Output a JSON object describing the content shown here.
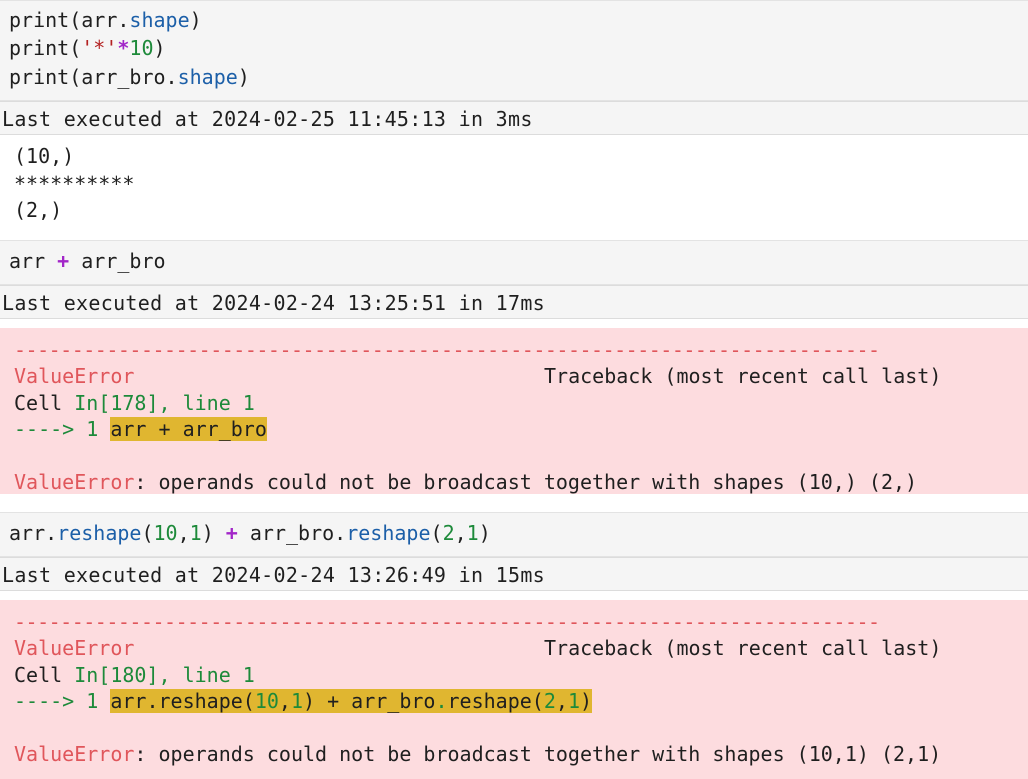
{
  "cells": [
    {
      "code_lines": [
        {
          "p1": "print(arr.",
          "p2": "shape",
          "p3": ")"
        },
        {
          "p1": "print(",
          "p2": "'*'",
          "p3": "*",
          "p4": "10",
          "p5": ")"
        },
        {
          "p1": "print(arr_bro.",
          "p2": "shape",
          "p3": ")"
        }
      ],
      "exec_info": "Last executed at 2024-02-25 11:45:13 in 3ms",
      "output_lines": [
        "(10,)",
        "**********",
        "(2,)"
      ]
    },
    {
      "code": {
        "p1": "arr ",
        "p2": "+",
        "p3": " arr_bro"
      },
      "exec_info": "Last executed at 2024-02-24 13:25:51 in 17ms",
      "error": {
        "separator": "---------------------------------------------------------------------------",
        "name": "ValueError",
        "traceback_label": "Traceback (most recent call last)",
        "cell_prefix": "Cell ",
        "cell_ref": "In[178], line 1",
        "arrow": "----> 1 ",
        "src": {
          "p1": "arr ",
          "p2": "+",
          "p3": " arr_bro"
        },
        "message": ": operands could not be broadcast together with shapes (10,) (2,)"
      }
    },
    {
      "code": {
        "p1": "arr.",
        "p2": "reshape",
        "p3": "(",
        "p4": "10",
        "p5": ",",
        "p6": "1",
        "p7": ") ",
        "p8": "+",
        "p9": " arr_bro.",
        "p10": "reshape",
        "p11": "(",
        "p12": "2",
        "p13": ",",
        "p14": "1",
        "p15": ")"
      },
      "exec_info": "Last executed at 2024-02-24 13:26:49 in 15ms",
      "error": {
        "separator": "---------------------------------------------------------------------------",
        "name": "ValueError",
        "traceback_label": "Traceback (most recent call last)",
        "cell_prefix": "Cell ",
        "cell_ref": "In[180], line 1",
        "arrow": "----> 1 ",
        "src": {
          "p1": "arr.reshape(",
          "p2": "10",
          "p3": ",",
          "p4": "1",
          "p5": ") + arr_bro",
          "p6": ".",
          "p7": "reshape(",
          "p8": "2",
          "p9": ",",
          "p10": "1",
          "p11": ")"
        },
        "message": ": operands could not be broadcast together with shapes (10,1) (2,1)"
      }
    }
  ]
}
